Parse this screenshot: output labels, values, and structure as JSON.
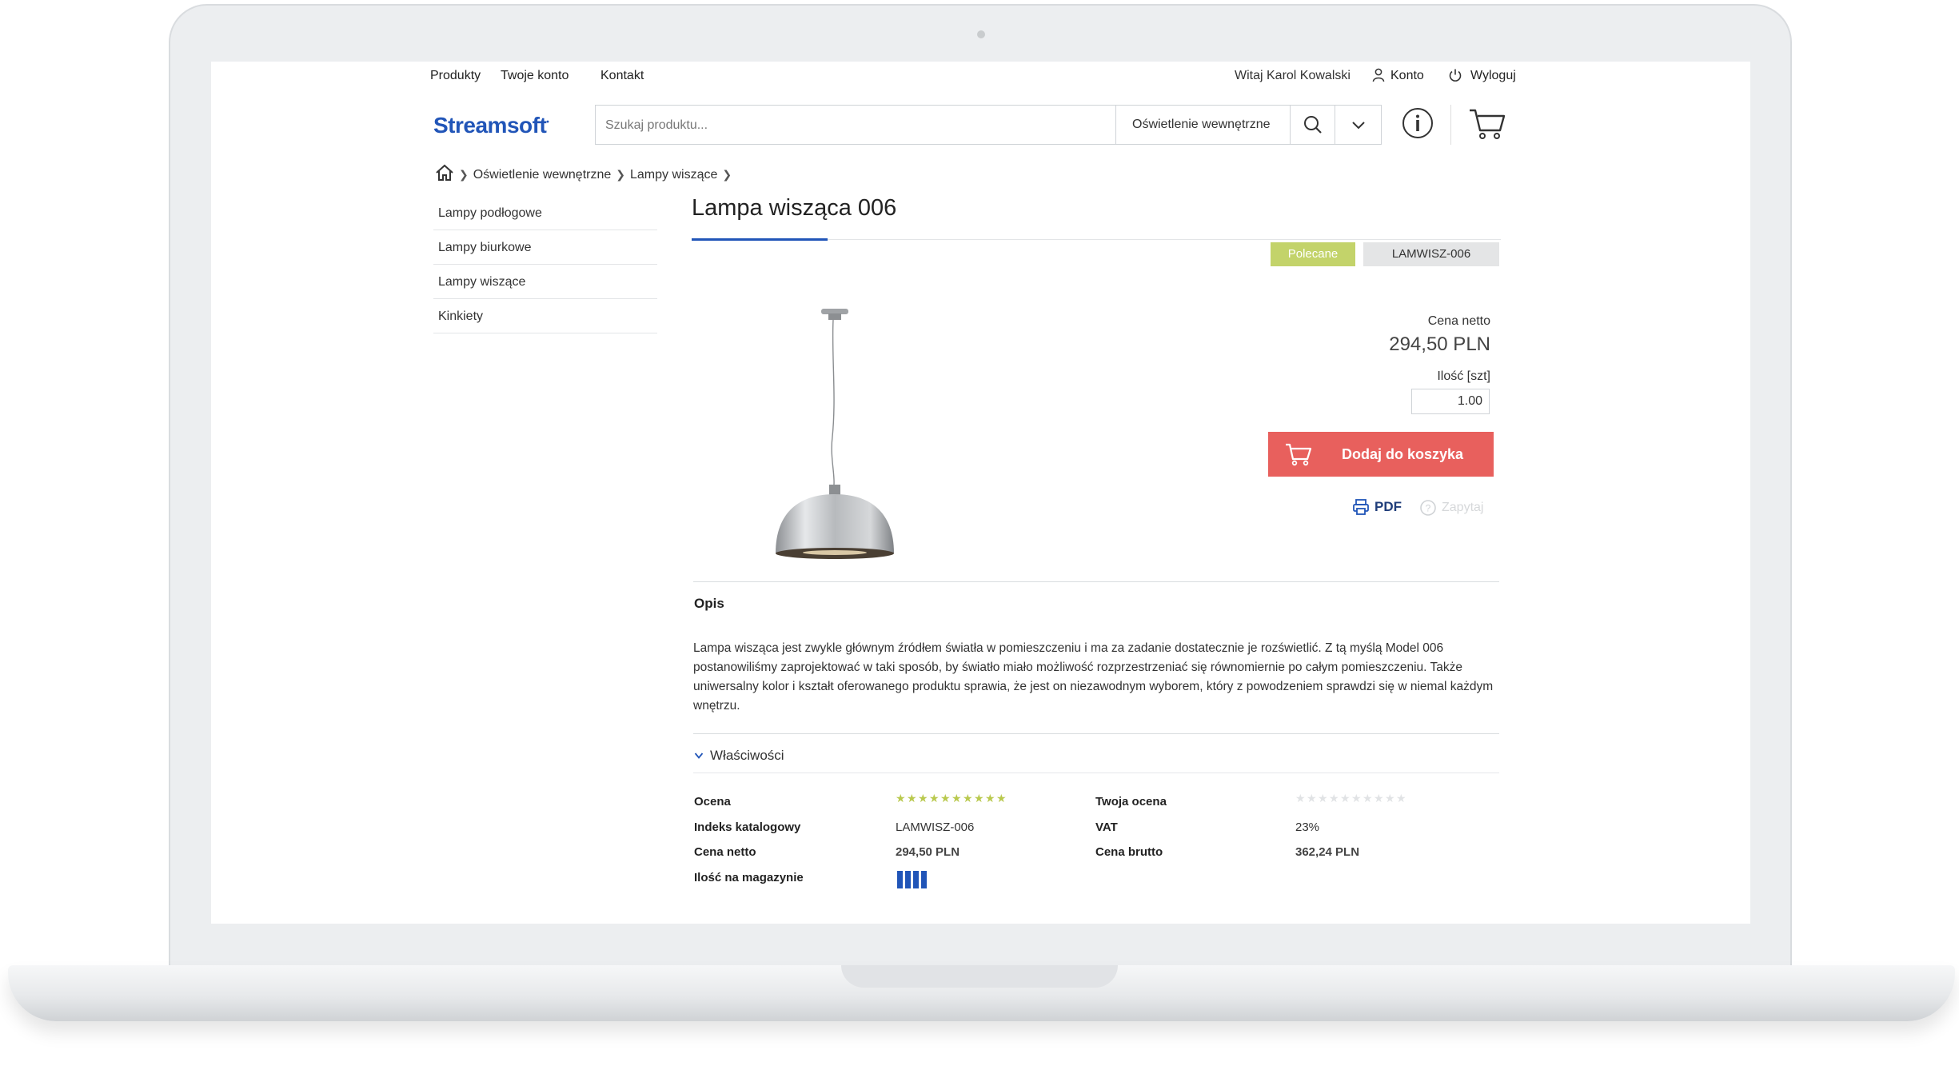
{
  "nav": {
    "products": "Produkty",
    "account": "Twoje konto",
    "contact": "Kontakt",
    "welcome": "Witaj Karol Kowalski",
    "konto": "Konto",
    "logout": "Wyloguj"
  },
  "logo": "Streamsoft",
  "search": {
    "placeholder": "Szukaj produktu...",
    "category": "Oświetlenie wewnętrzne"
  },
  "breadcrumb": [
    "Oświetlenie wewnętrzne",
    "Lampy wiszące"
  ],
  "sidebar": {
    "items": [
      {
        "label": "Lampy podłogowe"
      },
      {
        "label": "Lampy biurkowe"
      },
      {
        "label": "Lampy wiszące"
      },
      {
        "label": "Kinkiety"
      }
    ]
  },
  "product": {
    "title": "Lampa wisząca 006",
    "badge": "Polecane",
    "sku": "LAMWISZ-006",
    "price_label": "Cena netto",
    "price": "294,50 PLN",
    "qty_label": "Ilość [szt]",
    "qty": "1.00",
    "add_to_cart": "Dodaj do koszyka",
    "pdf": "PDF",
    "ask": "Zapytaj"
  },
  "description": {
    "heading": "Opis",
    "text": "Lampa wisząca jest zwykle głównym źródłem światła w pomieszczeniu i ma za zadanie dostatecznie je rozświetlić. Z tą myślą Model 006 postanowiliśmy zaprojektować w taki sposób, by światło miało możliwość rozprzestrzeniać się równomiernie po całym pomieszczeniu. Także uniwersalny kolor i kształt oferowanego produktu sprawia, że jest on niezawodnym wyborem, który z powodzeniem sprawdzi się w niemal każdym wnętrzu."
  },
  "properties": {
    "heading": "Właściwości",
    "rating_label": "Ocena",
    "rating": 5,
    "rating_max": 5,
    "your_rating_label": "Twoja ocena",
    "your_rating": 0,
    "index_label": "Indeks katalogowy",
    "index": "LAMWISZ-006",
    "vat_label": "VAT",
    "vat": "23%",
    "net_label": "Cena netto",
    "net": "294,50 PLN",
    "gross_label": "Cena brutto",
    "gross": "362,24 PLN",
    "stock_label": "Ilość na magazynie",
    "stock_level": 4,
    "stock_max": 4
  },
  "colors": {
    "brand": "#2155b8",
    "cta": "#e8605d",
    "badge": "#c3d36a",
    "star": "#b9c94e"
  }
}
